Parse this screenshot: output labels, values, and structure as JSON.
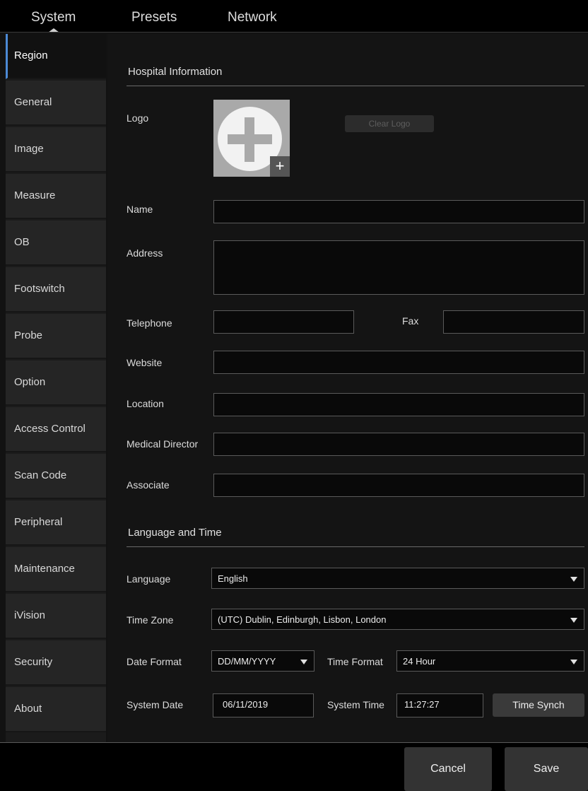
{
  "tabs": [
    "System",
    "Presets",
    "Network"
  ],
  "active_tab": "System",
  "sidebar": {
    "items": [
      {
        "label": "Region"
      },
      {
        "label": "General"
      },
      {
        "label": "Image"
      },
      {
        "label": "Measure"
      },
      {
        "label": "OB"
      },
      {
        "label": "Footswitch"
      },
      {
        "label": "Probe"
      },
      {
        "label": "Option"
      },
      {
        "label": "Access Control"
      },
      {
        "label": "Scan Code"
      },
      {
        "label": "Peripheral"
      },
      {
        "label": "Maintenance"
      },
      {
        "label": "iVision"
      },
      {
        "label": "Security"
      },
      {
        "label": "About"
      }
    ],
    "active": "Region"
  },
  "hospital": {
    "title": "Hospital Information",
    "logo_label": "Logo",
    "clear_logo": "Clear Logo",
    "name_label": "Name",
    "name_value": "",
    "address_label": "Address",
    "address_value": "",
    "telephone_label": "Telephone",
    "telephone_value": "",
    "fax_label": "Fax",
    "fax_value": "",
    "website_label": "Website",
    "website_value": "",
    "location_label": "Location",
    "location_value": "",
    "director_label": "Medical Director",
    "director_value": "",
    "associate_label": "Associate",
    "associate_value": ""
  },
  "lang_time": {
    "title": "Language and Time",
    "language_label": "Language",
    "language_value": "English",
    "timezone_label": "Time Zone",
    "timezone_value": "(UTC) Dublin, Edinburgh, Lisbon, London",
    "dateformat_label": "Date Format",
    "dateformat_value": "DD/MM/YYYY",
    "timeformat_label": "Time Format",
    "timeformat_value": "24 Hour",
    "sysdate_label": "System Date",
    "sysdate_value": "06/11/2019",
    "systime_label": "System Time",
    "systime_value": "11:27:27",
    "time_synch": "Time Synch"
  },
  "footer": {
    "cancel": "Cancel",
    "save": "Save"
  },
  "colors": {
    "accent": "#4c8ad6",
    "background": "#121212",
    "field_border": "#5a5a5a"
  }
}
